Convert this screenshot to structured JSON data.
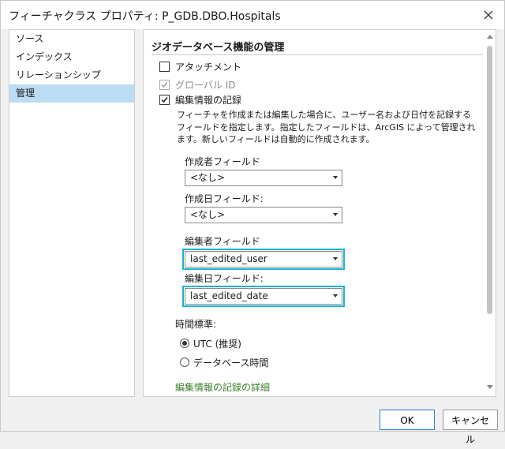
{
  "window": {
    "title": "フィーチャクラス プロパティ: P_GDB.DBO.Hospitals"
  },
  "nav": {
    "items": [
      {
        "label": "ソース",
        "selected": false
      },
      {
        "label": "インデックス",
        "selected": false
      },
      {
        "label": "リレーションシップ",
        "selected": false
      },
      {
        "label": "管理",
        "selected": true
      }
    ]
  },
  "main": {
    "section_title": "ジオデータベース機能の管理",
    "options": {
      "attachments": {
        "label": "アタッチメント",
        "checked": false,
        "enabled": true
      },
      "global_id": {
        "label": "グローバル ID",
        "checked": true,
        "enabled": false
      },
      "editor_tracking": {
        "label": "編集情報の記録",
        "checked": true,
        "enabled": true
      }
    },
    "description": "フィーチャを作成または編集した場合に、ユーザー名および日付を記録するフィールドを指定します。指定したフィールドは、ArcGIS によって管理されます。新しいフィールドは自動的に作成されます。",
    "fields": {
      "creator": {
        "label": "作成者フィールド",
        "value": "<なし>"
      },
      "create_date": {
        "label": "作成日フィールド:",
        "value": "<なし>"
      },
      "editor": {
        "label": "編集者フィールド",
        "value": "last_edited_user"
      },
      "edit_date": {
        "label": "編集日フィールド:",
        "value": "last_edited_date"
      }
    },
    "time_standard": {
      "label": "時間標準:",
      "options": [
        {
          "label": "UTC (推奨)",
          "selected": true
        },
        {
          "label": "データベース時間",
          "selected": false
        }
      ]
    },
    "details_link": "編集情報の記録の詳細"
  },
  "footer": {
    "ok_label": "OK",
    "cancel_label": "キャンセル"
  },
  "colors": {
    "highlight_border": "#18b4d6",
    "selection_bg": "#bcdcf4",
    "link": "#3a7e2a"
  }
}
